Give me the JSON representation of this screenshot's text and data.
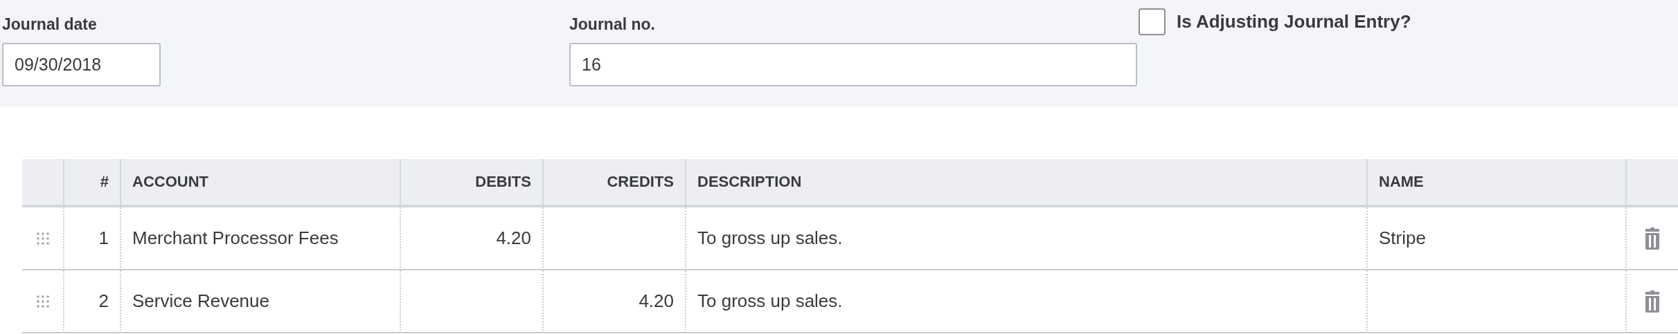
{
  "form": {
    "journal_date": {
      "label": "Journal date",
      "value": "09/30/2018"
    },
    "journal_no": {
      "label": "Journal no.",
      "value": "16"
    },
    "adjusting": {
      "label": "Is Adjusting Journal Entry?",
      "checked": false
    }
  },
  "table": {
    "columns": {
      "number": "#",
      "account": "ACCOUNT",
      "debits": "DEBITS",
      "credits": "CREDITS",
      "description": "DESCRIPTION",
      "name": "NAME"
    },
    "rows": [
      {
        "number": "1",
        "account": "Merchant Processor Fees",
        "debits": "4.20",
        "description": "To gross up sales.",
        "name": "Stripe"
      },
      {
        "number": "2",
        "account": "Service Revenue",
        "credits": "4.20",
        "description": "To gross up sales."
      }
    ]
  }
}
